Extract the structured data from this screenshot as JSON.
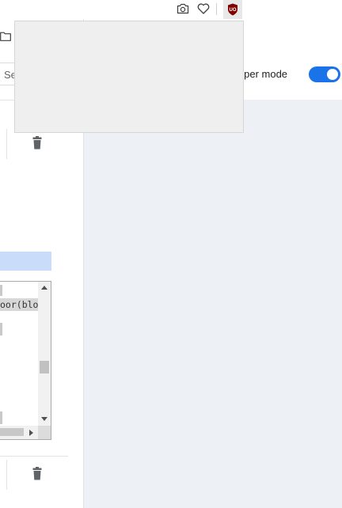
{
  "toolbar": {
    "icons": [
      "camera-icon",
      "heart-icon",
      "ublock-origin-icon"
    ],
    "ublock_logo_text": "UO"
  },
  "popup": {
    "state": "blank"
  },
  "page": {
    "search_placeholder": "Se",
    "developer_mode_label": "loper mode",
    "developer_mode_enabled": true
  },
  "code_editor": {
    "visible_line": "oor(blo"
  },
  "colors": {
    "accent": "#1a73e8",
    "highlight": "#c9dcfa",
    "panel_bg": "#edf1f6",
    "popup_bg": "#f0eff0",
    "ublock_red": "#800000"
  }
}
